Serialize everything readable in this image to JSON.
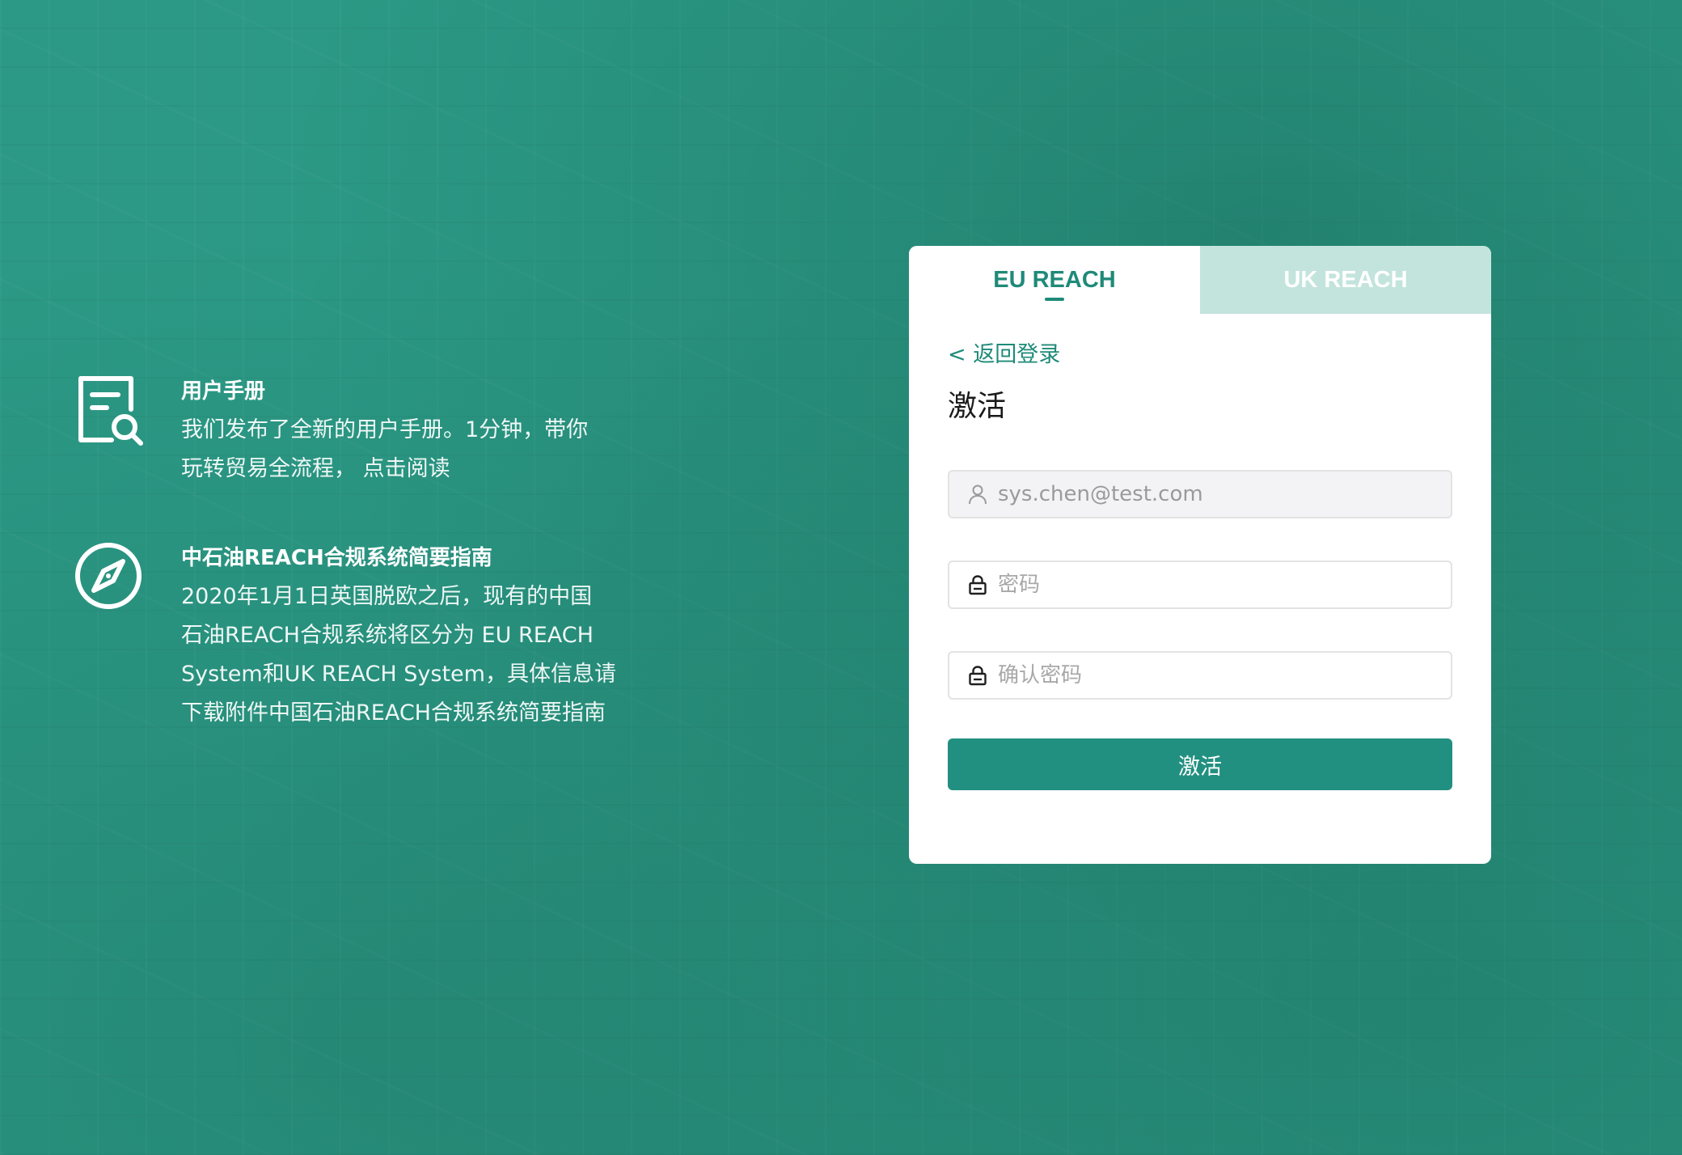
{
  "info": {
    "manual": {
      "icon": "document-search-icon",
      "title": "用户手册",
      "lines": [
        "我们发布了全新的用户手册。1分钟，带你",
        "玩转贸易全流程，  点击阅读"
      ]
    },
    "guide": {
      "icon": "compass-icon",
      "title": "中石油REACH合规系统简要指南",
      "lines": [
        "2020年1月1日英国脱欧之后，现有的中国",
        "石油REACH合规系统将区分为 EU REACH",
        "System和UK REACH System，具体信息请",
        "下载附件中国石油REACH合规系统简要指南"
      ]
    }
  },
  "card": {
    "tabs": [
      {
        "label": "EU REACH",
        "active": true
      },
      {
        "label": "UK REACH",
        "active": false
      }
    ],
    "back_link": "< 返回登录",
    "title": "激活",
    "fields": {
      "email": {
        "icon": "user-icon",
        "value": "sys.chen@test.com"
      },
      "password": {
        "icon": "lock-icon",
        "placeholder": "密码"
      },
      "confirm_password": {
        "icon": "lock-icon",
        "placeholder": "确认密码"
      }
    },
    "submit_label": "激活"
  },
  "colors": {
    "background": "#2b9985",
    "accent": "#1f8a78",
    "inactive_tab": "#c3e4dc"
  }
}
